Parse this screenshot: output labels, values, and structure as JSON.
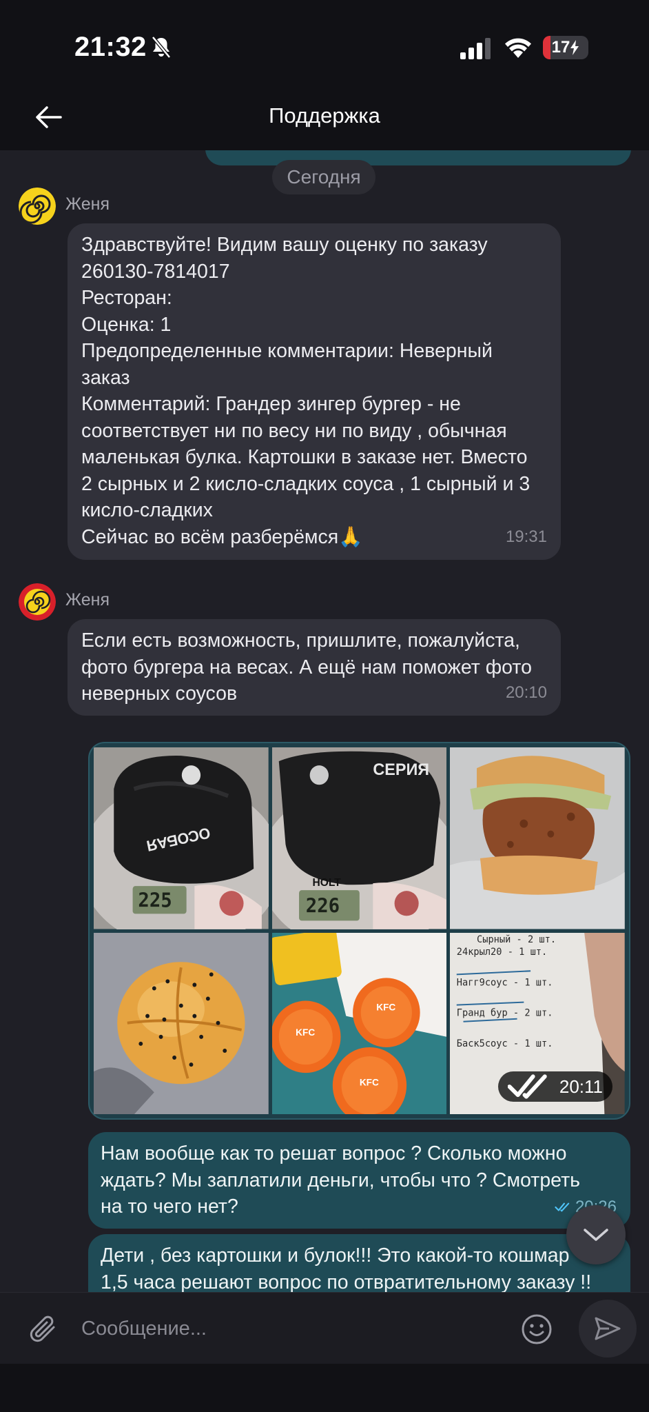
{
  "status_bar": {
    "time": "21:32",
    "battery": "17",
    "battery_level": 0.17
  },
  "header": {
    "title": "Поддержка"
  },
  "chat": {
    "date_divider": "Сегодня",
    "messages": [
      {
        "sender": "Женя",
        "lines": [
          "Здравствуйте! Видим вашу оценку по заказу",
          "260130-7814017",
          "Ресторан:",
          "Оценка: 1",
          "Предопределенные комментарии:  Неверный",
          "заказ",
          "Комментарий: Грандер зингер бургер  - не",
          "соответствует ни по весу ни по виду , обычная",
          "маленькая булка. Картошки в заказе нет. Вместо",
          "2 сырных и 2 кисло-сладких соуса , 1 сырный и 3",
          "кисло-сладких",
          "Сейчас во всём разберёмся🙏"
        ],
        "time": "19:31"
      },
      {
        "sender": "Женя",
        "lines": [
          "Если есть возможность, пришлите, пожалуйста,",
          "фото бургера на весах. А ещё нам поможет фото",
          "неверных соусов"
        ],
        "time": "20:10"
      }
    ],
    "photos": {
      "time": "20:11",
      "scale_readings": [
        "225",
        "226"
      ],
      "receipt_lines": [
        "Сырный - 2 шт.",
        "24крыл20 - 1 шт.",
        "Нагг9соус - 1 шт.",
        "Гранд бур - 2 шт.",
        "Баск5соус - 1 шт."
      ]
    },
    "outgoing": [
      {
        "lines": [
          "Нам вообще как то решат вопрос ? Сколько можно",
          "ждать? Мы заплатили деньги, чтобы что ? Смотреть",
          "на то чего нет?"
        ],
        "time": "20:26"
      },
      {
        "lines": [
          "Дети , без картошки и булок!!! Это какой-то кошмар",
          "1,5 часа решают вопрос по отвратительному заказу !!"
        ]
      }
    ]
  },
  "composer": {
    "placeholder": "Сообщение..."
  },
  "colors": {
    "incoming": "#31313a",
    "outgoing": "#1f4b56",
    "background": "#1f1f26"
  }
}
